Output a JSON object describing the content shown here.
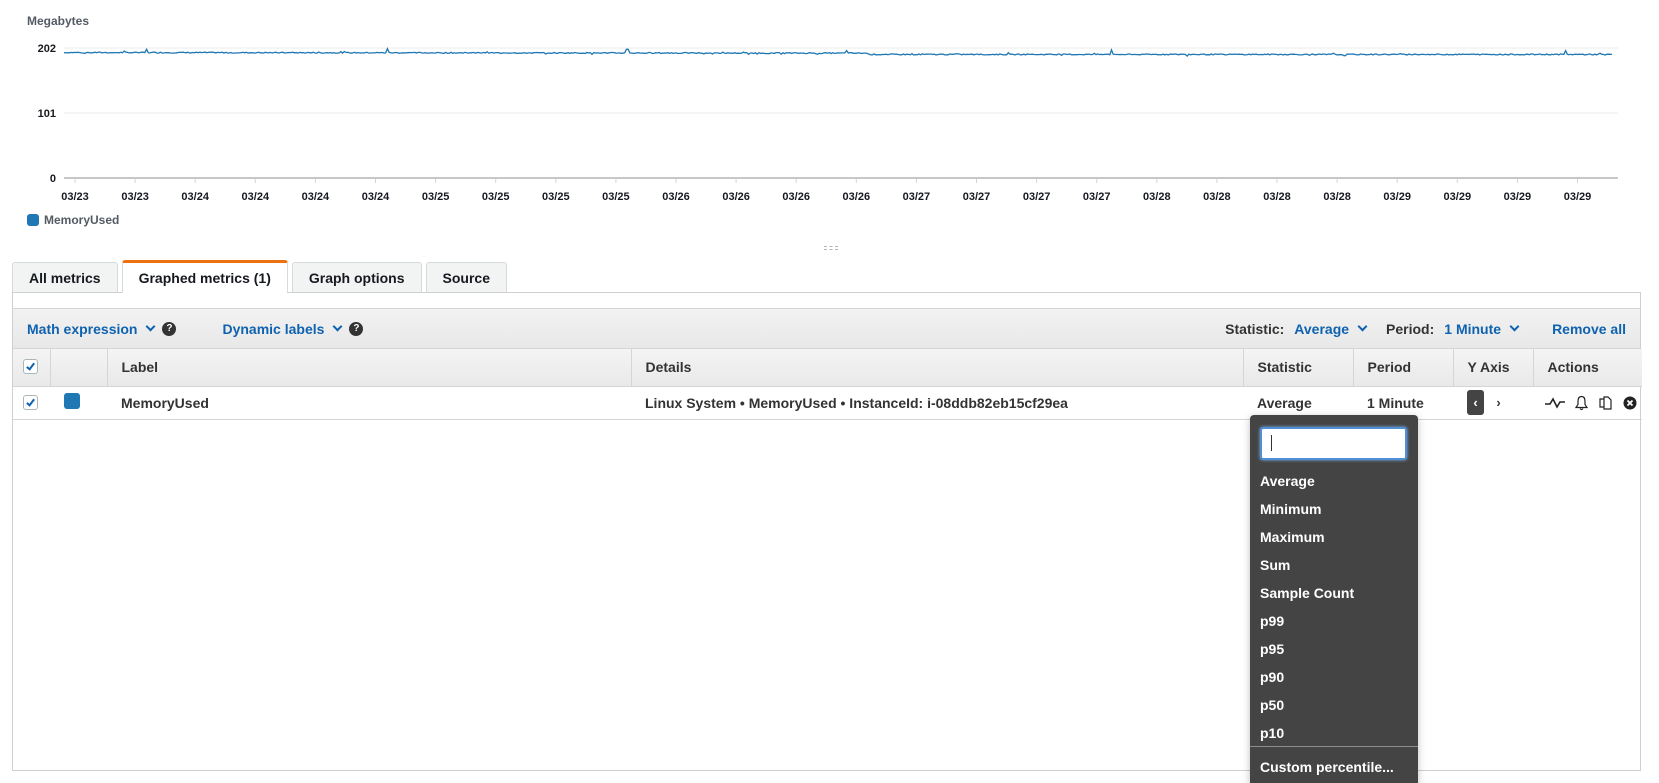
{
  "chart_data": {
    "type": "line",
    "title": "",
    "ylabel": "Megabytes",
    "xlabel": "",
    "ylim": [
      0,
      202
    ],
    "yticks": [
      0,
      101,
      202
    ],
    "xtick_labels": [
      "03/23",
      "03/23",
      "03/24",
      "03/24",
      "03/24",
      "03/24",
      "03/25",
      "03/25",
      "03/25",
      "03/25",
      "03/26",
      "03/26",
      "03/26",
      "03/26",
      "03/27",
      "03/27",
      "03/27",
      "03/27",
      "03/28",
      "03/28",
      "03/28",
      "03/28",
      "03/29",
      "03/29",
      "03/29",
      "03/29"
    ],
    "grid": true,
    "legend_position": "bottom-left",
    "series": [
      {
        "name": "MemoryUsed",
        "color": "#1f77b4",
        "segments": [
          {
            "x_start": "03/23",
            "x_end": "03/26",
            "approx_value": 195
          },
          {
            "x_start": "03/26",
            "x_end": "03/29",
            "approx_value": 192
          }
        ],
        "spikes": [
          {
            "x_fraction": 0.053,
            "value": 200
          },
          {
            "x_fraction": 0.209,
            "value": 201
          },
          {
            "x_fraction": 0.364,
            "value": 200
          },
          {
            "x_fraction": 0.506,
            "value": 198
          },
          {
            "x_fraction": 0.677,
            "value": 199
          },
          {
            "x_fraction": 0.97,
            "value": 198
          }
        ]
      }
    ]
  },
  "legend": {
    "label": "MemoryUsed",
    "color": "#1f77b4"
  },
  "tabs": [
    {
      "label": "All metrics",
      "active": false
    },
    {
      "label": "Graphed metrics (1)",
      "active": true
    },
    {
      "label": "Graph options",
      "active": false
    },
    {
      "label": "Source",
      "active": false
    }
  ],
  "toolbar": {
    "math_expression": "Math expression",
    "dynamic_labels": "Dynamic labels",
    "help_glyph": "?",
    "statistic_label": "Statistic:",
    "statistic_value": "Average",
    "period_label": "Period:",
    "period_value": "1 Minute",
    "remove_all": "Remove all"
  },
  "table": {
    "headers": {
      "label": "Label",
      "details": "Details",
      "statistic": "Statistic",
      "period": "Period",
      "y_axis": "Y Axis",
      "actions": "Actions"
    },
    "rows": [
      {
        "checked": true,
        "color": "#1f77b4",
        "label": "MemoryUsed",
        "details": "Linux System • MemoryUsed • InstanceId: i-08ddb82eb15cf29ea",
        "statistic": "Average",
        "period": "1 Minute",
        "y_axis": {
          "left": "‹",
          "right": "›",
          "selected": "left"
        },
        "action_icons": [
          "graph-icon",
          "bell-icon",
          "duplicate-icon",
          "remove-icon"
        ]
      }
    ]
  },
  "statistic_dropdown": {
    "search_value": "",
    "options": [
      "Average",
      "Minimum",
      "Maximum",
      "Sum",
      "Sample Count",
      "p99",
      "p95",
      "p90",
      "p50",
      "p10"
    ],
    "custom": "Custom percentile..."
  },
  "colors": {
    "accent": "#ec7211",
    "link": "#0f62af",
    "series": "#1f77b4",
    "dropdown_bg": "#444444"
  }
}
